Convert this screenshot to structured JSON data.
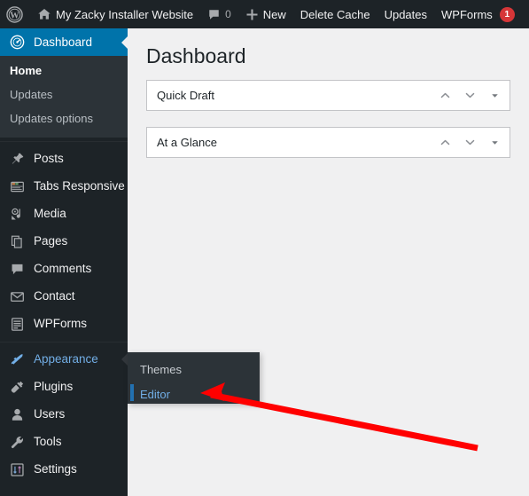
{
  "adminbar": {
    "items": [
      {
        "name": "wordpress-logo",
        "icon": "wordpress-icon",
        "label": ""
      },
      {
        "name": "site-name",
        "icon": "home-icon",
        "label": "My Zacky Installer Website"
      },
      {
        "name": "comments",
        "icon": "comment-icon",
        "label": "0"
      },
      {
        "name": "new-content",
        "icon": "plus-icon",
        "label": "New"
      },
      {
        "name": "delete-cache",
        "icon": "",
        "label": "Delete Cache"
      },
      {
        "name": "updates",
        "icon": "",
        "label": "Updates"
      },
      {
        "name": "wpforms",
        "icon": "",
        "label": "WPForms",
        "badge": "1"
      }
    ]
  },
  "sidebar": {
    "dashboard": {
      "label": "Dashboard",
      "icon": "dashboard-icon",
      "active": true,
      "submenu": [
        {
          "label": "Home",
          "current": true
        },
        {
          "label": "Updates",
          "current": false
        },
        {
          "label": "Updates options",
          "current": false
        }
      ]
    },
    "items": [
      {
        "label": "Posts",
        "icon": "pin-icon"
      },
      {
        "label": "Tabs Responsive",
        "icon": "window-icon"
      },
      {
        "label": "Media",
        "icon": "media-icon"
      },
      {
        "label": "Pages",
        "icon": "pages-icon"
      },
      {
        "label": "Comments",
        "icon": "comment-icon"
      },
      {
        "label": "Contact",
        "icon": "envelope-icon"
      },
      {
        "label": "WPForms",
        "icon": "form-icon"
      },
      {
        "label": "Appearance",
        "icon": "brush-icon",
        "hovered": true
      },
      {
        "label": "Plugins",
        "icon": "plug-icon"
      },
      {
        "label": "Users",
        "icon": "user-icon"
      },
      {
        "label": "Tools",
        "icon": "wrench-icon"
      },
      {
        "label": "Settings",
        "icon": "settings-icon"
      }
    ]
  },
  "flyout": {
    "items": [
      {
        "label": "Themes",
        "current": false
      },
      {
        "label": "Editor",
        "current": true
      }
    ]
  },
  "main": {
    "title": "Dashboard",
    "panels": [
      {
        "title": "Quick Draft",
        "controls": [
          "chevron-up-icon",
          "chevron-down-icon",
          "caret-down-icon"
        ]
      },
      {
        "title": "At a Glance",
        "controls": [
          "chevron-up-icon",
          "chevron-down-icon",
          "caret-down-icon"
        ]
      }
    ]
  },
  "annotation": {
    "name": "red-arrow-pointing-to-editor",
    "color": "#ff0000"
  },
  "colors": {
    "adminbar_bg": "#1d2327",
    "sidebar_bg": "#1d2327",
    "active_blue": "#0073aa",
    "link_blue": "#72aee6",
    "content_bg": "#f0f0f1",
    "badge_red": "#d63638",
    "annotation_red": "#ff0000"
  }
}
